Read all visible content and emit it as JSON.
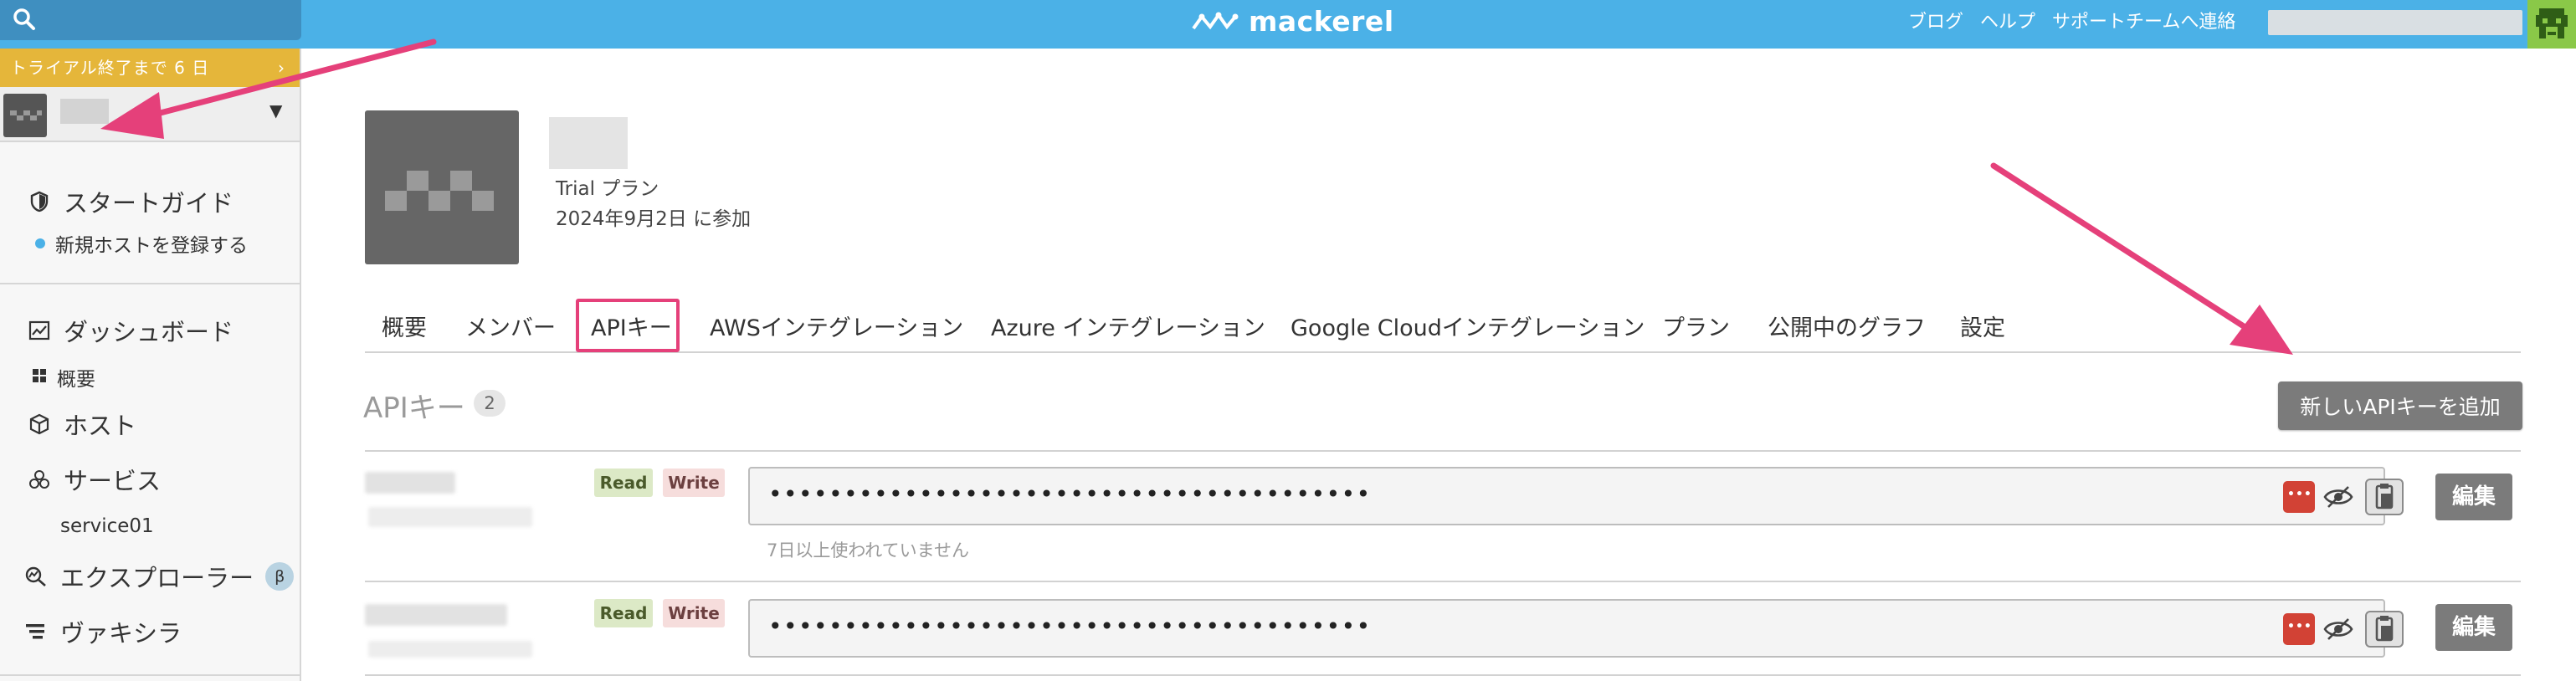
{
  "header": {
    "brand": "mackerel",
    "links": [
      "ブログ",
      "ヘルプ",
      "サポートチームへ連絡"
    ]
  },
  "sidebar": {
    "trial_banner": "トライアル終了まで 6 日",
    "trial_chevron": "›",
    "org_caret": "▼",
    "start_guide": "スタートガイド",
    "register_host": "新規ホストを登録する",
    "dashboard": "ダッシュボード",
    "overview": "概要",
    "hosts": "ホスト",
    "services": "サービス",
    "service01": "service01",
    "explorer": "エクスプローラー",
    "beta": "β",
    "vaxila": "ヴァキシラ"
  },
  "org": {
    "plan": "Trial プラン",
    "joined": "2024年9月2日 に参加"
  },
  "tabs": [
    "概要",
    "メンバー",
    "APIキー",
    "AWSインテグレーション",
    "Azure インテグレーション",
    "Google Cloudインテグレーション",
    "プラン",
    "公開中のグラフ",
    "設定"
  ],
  "active_tab": "APIキー",
  "api_keys": {
    "title": "APIキー",
    "count": "2",
    "new_button": "新しいAPIキーを追加",
    "rows": [
      {
        "read": "Read",
        "write": "Write",
        "masked": "••••••••••••••••••••••••••••••••••••••••",
        "edit": "編集",
        "note": "7日以上使われていません"
      },
      {
        "read": "Read",
        "write": "Write",
        "masked": "••••••••••••••••••••••••••••••••••••••••",
        "edit": "編集"
      }
    ]
  },
  "colors": {
    "header_bg": "#4bb1e7",
    "trial_banner": "#e5b63a",
    "highlight": "#e5407a",
    "button_gray": "#7b7b7b"
  }
}
